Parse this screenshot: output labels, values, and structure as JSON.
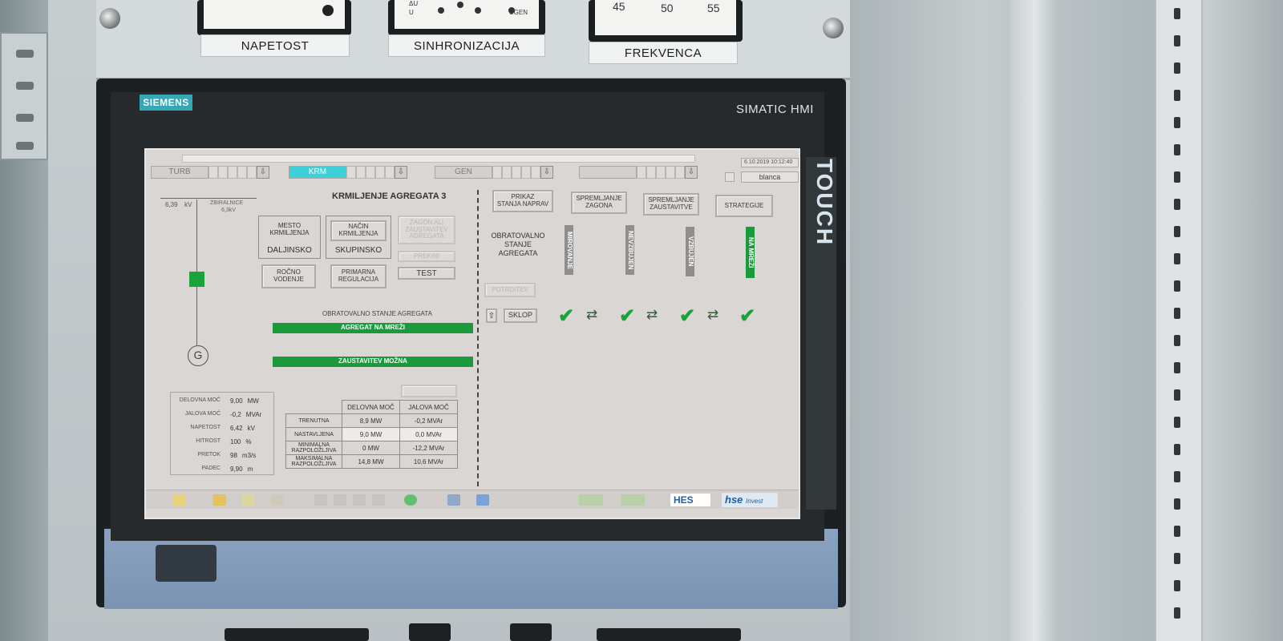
{
  "meters": [
    {
      "label": "NAPETOST"
    },
    {
      "label": "SINHRONIZACIJA",
      "face_marks": [
        "ΔU",
        "U",
        "UGEN"
      ]
    },
    {
      "label": "FREKVENCA",
      "scale": [
        "45",
        "50",
        "55"
      ]
    }
  ],
  "device": {
    "brand": "SIEMENS",
    "model": "SIMATIC HMI",
    "touch_label": "TOUCH"
  },
  "nav": {
    "groups": [
      {
        "label": "TURB",
        "active": false
      },
      {
        "label": "KRM",
        "active": true
      },
      {
        "label": "GEN",
        "active": false
      }
    ],
    "date": "6.10.2019 10:12:40",
    "user": "blanca"
  },
  "busbar": {
    "voltage": "6,39",
    "unit": "kV",
    "label": "ZBIRALNICE",
    "sublabel": "6,3kV",
    "generator_symbol": "G"
  },
  "control": {
    "title": "KRMILJENJE AGREGATA 3",
    "mesto": {
      "label": "MESTO\nKRMILJENJA",
      "value": "DALJINSKO"
    },
    "nacin": {
      "label": "NAČIN\nKRMILJENJA",
      "value": "SKUPINSKO"
    },
    "zagon_button": "ZAGON ALI\nZAUSTAVITEV\nAGREGATA",
    "prekini_button": "PREKINI",
    "test_button": "TEST",
    "rocno_button": "ROČNO\nVODENJE",
    "primarna_button": "PRIMARNA\nREGULACIJA",
    "state_caption": "OBRATOVALNO STANJE AGREGATA",
    "state_bar": "AGREGAT NA MREŽI",
    "stop_bar": "ZAUSTAVITEV MOŽNA",
    "disabled_small_button": ""
  },
  "measurements": [
    {
      "label": "DELOVNA MOČ",
      "value": "9,00",
      "unit": "MW"
    },
    {
      "label": "JALOVA MOČ",
      "value": "-0,2",
      "unit": "MVAr"
    },
    {
      "label": "NAPETOST",
      "value": "6,42",
      "unit": "kV"
    },
    {
      "label": "HITROST",
      "value": "100",
      "unit": "%"
    },
    {
      "label": "PRETOK",
      "value": "98",
      "unit": "m3/s"
    },
    {
      "label": "PADEC",
      "value": "9,90",
      "unit": "m"
    }
  ],
  "power_table": {
    "headers": [
      "",
      "DELOVNA MOČ",
      "JALOVA MOČ"
    ],
    "rows": [
      {
        "label": "TRENUTNA",
        "p": "8,9  MW",
        "q": "-0,2  MVAr"
      },
      {
        "label": "NASTAVLJENA",
        "p": "9,0    MW",
        "q": "0,0  MVAr"
      },
      {
        "label": "MINIMALNA\nRAZPOLOŽLJIVA",
        "p": "0  MW",
        "q": "-12,2 MVAr"
      },
      {
        "label": "MAKSIMALNA\nRAZPOLOŽLJIVA",
        "p": "14,8 MW",
        "q": "10,6 MVAr"
      }
    ]
  },
  "right_panel": {
    "buttons": [
      "PRIKAZ\nSTANJA NAPRAV",
      "SPREMLJANJE\nZAGONA",
      "SPREMLJANJE\nZAUSTAVITVE",
      "STRATEGIJE"
    ],
    "obratovalno_label": "OBRATOVALNO\nSTANJE\nAGREGATA",
    "states": [
      {
        "label": "MIROVANJE",
        "color": "gray"
      },
      {
        "label": "NEVZBUJEN",
        "color": "gray"
      },
      {
        "label": "VZBUJEN",
        "color": "gray"
      },
      {
        "label": "NA MREŽI",
        "color": "green"
      }
    ],
    "potrditev_button": "POTRDITEV",
    "sklop_button": "SKLOP",
    "sklop_arrow": "⇧",
    "check_symbol": "✔",
    "transfer_symbol": "⇄"
  },
  "logos": {
    "hes": "HES",
    "hse": "hse",
    "hse_sub": "Invest"
  },
  "colors": {
    "accent_cyan": "#3ed0d8",
    "status_green": "#1a9a3a",
    "screen_bg": "#d9d6d4",
    "siemens_teal": "#35a7b5"
  }
}
